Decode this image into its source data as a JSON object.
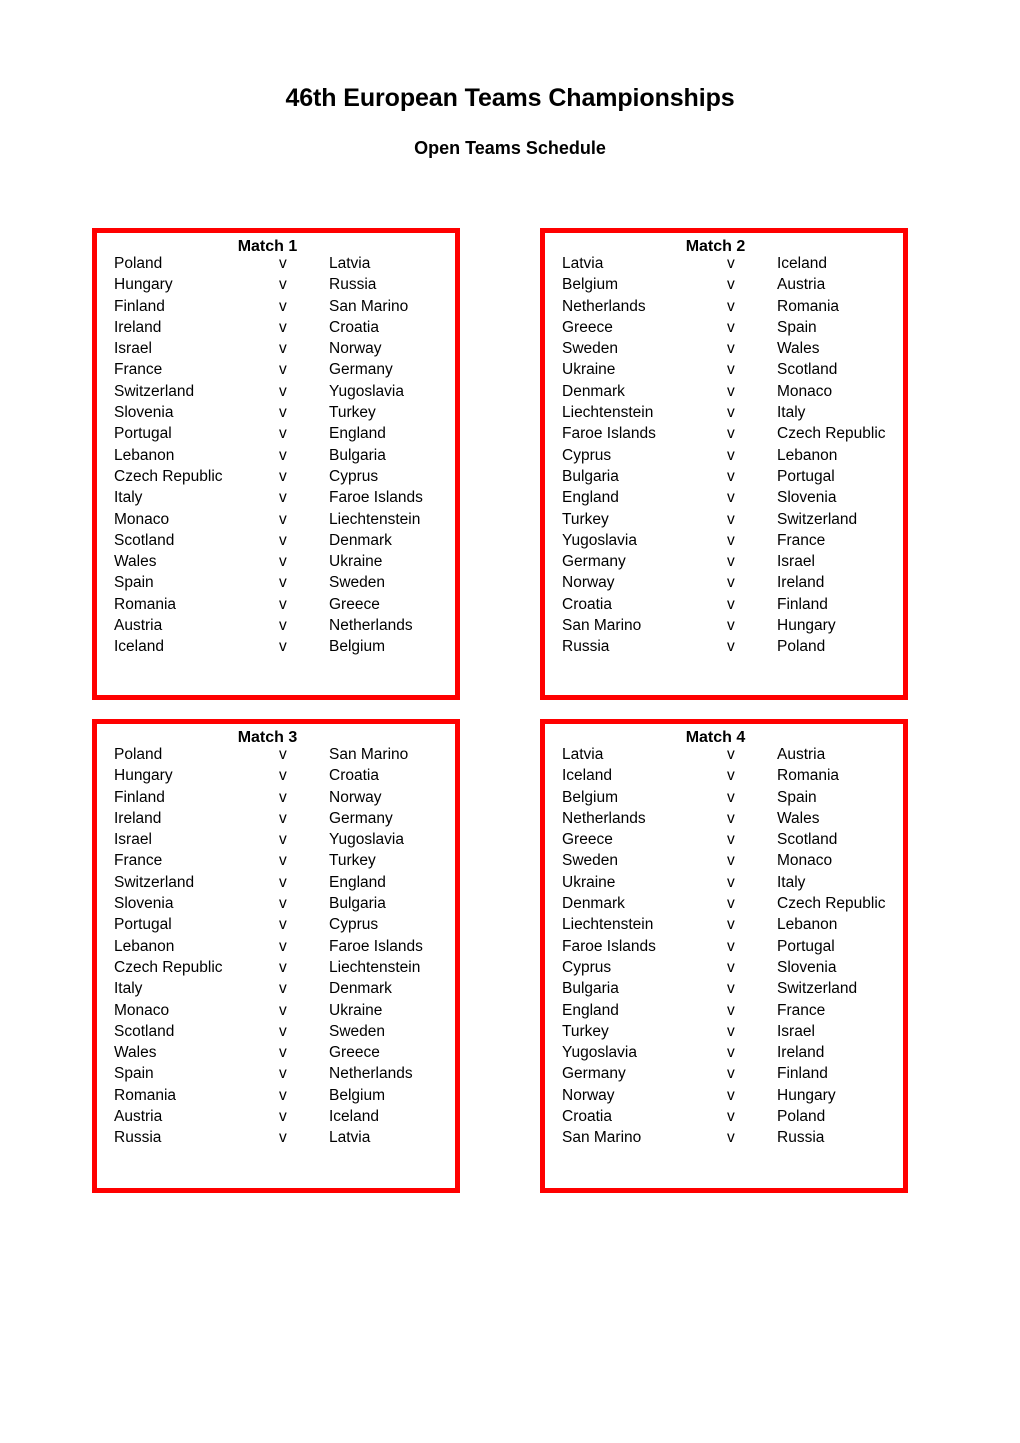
{
  "document": {
    "title": "46th European Teams Championships",
    "subtitle": "Open Teams Schedule"
  },
  "labels": {
    "versus": "v"
  },
  "matches": [
    {
      "title": "Match 1",
      "fixtures": [
        {
          "home": "Poland",
          "away": "Latvia"
        },
        {
          "home": "Hungary",
          "away": "Russia"
        },
        {
          "home": "Finland",
          "away": "San Marino"
        },
        {
          "home": "Ireland",
          "away": "Croatia"
        },
        {
          "home": "Israel",
          "away": "Norway"
        },
        {
          "home": "France",
          "away": "Germany"
        },
        {
          "home": "Switzerland",
          "away": "Yugoslavia"
        },
        {
          "home": "Slovenia",
          "away": "Turkey"
        },
        {
          "home": "Portugal",
          "away": "England"
        },
        {
          "home": "Lebanon",
          "away": "Bulgaria"
        },
        {
          "home": "Czech Republic",
          "away": "Cyprus"
        },
        {
          "home": "Italy",
          "away": "Faroe Islands"
        },
        {
          "home": "Monaco",
          "away": "Liechtenstein"
        },
        {
          "home": "Scotland",
          "away": "Denmark"
        },
        {
          "home": "Wales",
          "away": "Ukraine"
        },
        {
          "home": "Spain",
          "away": "Sweden"
        },
        {
          "home": "Romania",
          "away": "Greece"
        },
        {
          "home": "Austria",
          "away": "Netherlands"
        },
        {
          "home": "Iceland",
          "away": "Belgium"
        }
      ]
    },
    {
      "title": "Match 2",
      "fixtures": [
        {
          "home": "Latvia",
          "away": "Iceland"
        },
        {
          "home": "Belgium",
          "away": "Austria"
        },
        {
          "home": "Netherlands",
          "away": "Romania"
        },
        {
          "home": "Greece",
          "away": "Spain"
        },
        {
          "home": "Sweden",
          "away": "Wales"
        },
        {
          "home": "Ukraine",
          "away": "Scotland"
        },
        {
          "home": "Denmark",
          "away": "Monaco"
        },
        {
          "home": "Liechtenstein",
          "away": "Italy"
        },
        {
          "home": "Faroe Islands",
          "away": "Czech Republic"
        },
        {
          "home": "Cyprus",
          "away": "Lebanon"
        },
        {
          "home": "Bulgaria",
          "away": "Portugal"
        },
        {
          "home": "England",
          "away": "Slovenia"
        },
        {
          "home": "Turkey",
          "away": "Switzerland"
        },
        {
          "home": "Yugoslavia",
          "away": "France"
        },
        {
          "home": "Germany",
          "away": "Israel"
        },
        {
          "home": "Norway",
          "away": "Ireland"
        },
        {
          "home": "Croatia",
          "away": "Finland"
        },
        {
          "home": "San Marino",
          "away": "Hungary"
        },
        {
          "home": "Russia",
          "away": "Poland"
        }
      ]
    },
    {
      "title": "Match 3",
      "fixtures": [
        {
          "home": "Poland",
          "away": "San Marino"
        },
        {
          "home": "Hungary",
          "away": "Croatia"
        },
        {
          "home": "Finland",
          "away": "Norway"
        },
        {
          "home": "Ireland",
          "away": "Germany"
        },
        {
          "home": "Israel",
          "away": "Yugoslavia"
        },
        {
          "home": "France",
          "away": "Turkey"
        },
        {
          "home": "Switzerland",
          "away": "England"
        },
        {
          "home": "Slovenia",
          "away": "Bulgaria"
        },
        {
          "home": "Portugal",
          "away": "Cyprus"
        },
        {
          "home": "Lebanon",
          "away": "Faroe Islands"
        },
        {
          "home": "Czech Republic",
          "away": "Liechtenstein"
        },
        {
          "home": "Italy",
          "away": "Denmark"
        },
        {
          "home": "Monaco",
          "away": "Ukraine"
        },
        {
          "home": "Scotland",
          "away": "Sweden"
        },
        {
          "home": "Wales",
          "away": "Greece"
        },
        {
          "home": "Spain",
          "away": "Netherlands"
        },
        {
          "home": "Romania",
          "away": "Belgium"
        },
        {
          "home": "Austria",
          "away": "Iceland"
        },
        {
          "home": "Russia",
          "away": "Latvia"
        }
      ]
    },
    {
      "title": "Match 4",
      "fixtures": [
        {
          "home": "Latvia",
          "away": "Austria"
        },
        {
          "home": "Iceland",
          "away": "Romania"
        },
        {
          "home": "Belgium",
          "away": "Spain"
        },
        {
          "home": "Netherlands",
          "away": "Wales"
        },
        {
          "home": "Greece",
          "away": "Scotland"
        },
        {
          "home": "Sweden",
          "away": "Monaco"
        },
        {
          "home": "Ukraine",
          "away": "Italy"
        },
        {
          "home": "Denmark",
          "away": "Czech Republic"
        },
        {
          "home": "Liechtenstein",
          "away": "Lebanon"
        },
        {
          "home": "Faroe Islands",
          "away": "Portugal"
        },
        {
          "home": "Cyprus",
          "away": "Slovenia"
        },
        {
          "home": "Bulgaria",
          "away": "Switzerland"
        },
        {
          "home": "England",
          "away": "France"
        },
        {
          "home": "Turkey",
          "away": "Israel"
        },
        {
          "home": "Yugoslavia",
          "away": "Ireland"
        },
        {
          "home": "Germany",
          "away": "Finland"
        },
        {
          "home": "Norway",
          "away": "Hungary"
        },
        {
          "home": "Croatia",
          "away": "Poland"
        },
        {
          "home": "San Marino",
          "away": "Russia"
        }
      ]
    }
  ],
  "colors": {
    "box_border": "#ff0000",
    "text": "#000000",
    "page_background": "#ffffff"
  }
}
